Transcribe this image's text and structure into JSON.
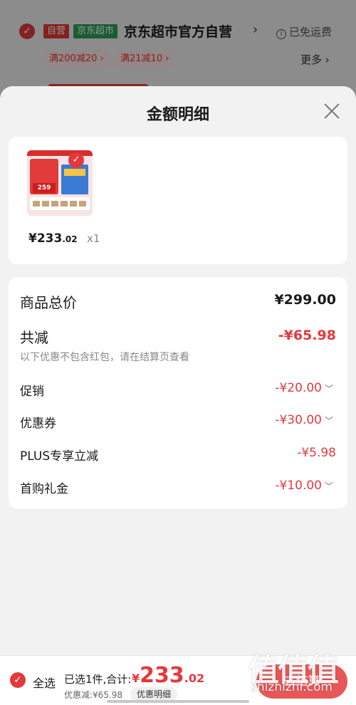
{
  "background_cart": {
    "tag_self": "自营",
    "tag_mart": "京东超市",
    "store_name": "京东超市官方自营",
    "free_shipping": "已免运费",
    "promos": [
      "满200减20 ›",
      "满21减10 ›"
    ],
    "more": "更多 ›"
  },
  "sheet": {
    "title": "金额明细"
  },
  "product": {
    "thumb_price": "259",
    "price_main": "¥233",
    "price_cents": ".02",
    "qty": "x1"
  },
  "breakdown": {
    "total_label": "商品总价",
    "total_value": "¥299.00",
    "reduce_label": "共减",
    "reduce_value": "-¥65.98",
    "reduce_note": "以下优惠不包含红包，请在结算页查看",
    "lines": [
      {
        "label": "促销",
        "value": "-¥20.00"
      },
      {
        "label": "优惠券",
        "value": "-¥30.00"
      },
      {
        "label": "PLUS专享立减",
        "value": "-¥5.98"
      },
      {
        "label": "首购礼金",
        "value": "-¥10.00"
      }
    ]
  },
  "bottom_bar": {
    "select_all": "全选",
    "selected_text": "已选1件,合计:",
    "sum_yen": "¥",
    "sum_main": "233",
    "sum_cents": ".02",
    "discount_text": "优惠减:¥65.98",
    "detail_chip": "优惠明细",
    "checkout": "去结算"
  },
  "watermark": {
    "chars": "值值值",
    "url": "zhizhizhi.com"
  },
  "colors": {
    "accent": "#e4393c",
    "mart_green": "#2ba05a",
    "sheet_bg": "#f2f2f2"
  }
}
